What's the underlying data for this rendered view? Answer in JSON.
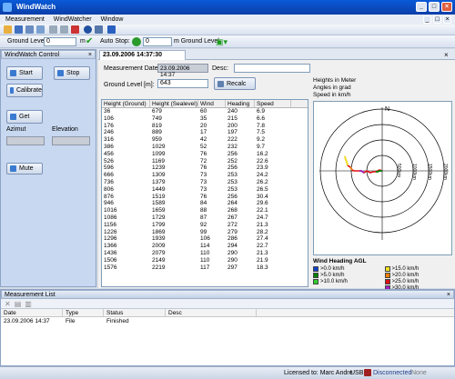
{
  "window": {
    "title": "WindWatch"
  },
  "menu": [
    "Measurement",
    "WindWatcher",
    "Window"
  ],
  "toolbar2": {
    "ground_level_label": "Ground Level:",
    "ground_level_value": "0",
    "ground_level_unit": "m",
    "auto_stop_label": "Auto Stop:",
    "auto_stop_value": "0",
    "m_ground_level_label": "m Ground Level"
  },
  "left_panel": {
    "title": "WindWatch Control",
    "start": "Start",
    "stop": "Stop",
    "calibrate": "Calibrate",
    "get": "Get",
    "azimut": "Azimut",
    "elevation": "Elevation",
    "mute": "Mute"
  },
  "tab": {
    "label": "23.09.2006 14:37:30"
  },
  "form": {
    "measurement_date_label": "Measurement Date:",
    "measurement_date_value": "23.09.2006 14:37",
    "desc_label": "Desc:",
    "desc_value": "",
    "ground_level_label": "Ground Level [m]:",
    "ground_level_value": "643",
    "recalc": "Recalc"
  },
  "info": [
    "Heights in Meter",
    "Angles in grad",
    "Speed in km/h"
  ],
  "table": {
    "headers": [
      "Height (Ground)",
      "Height (Sealevel)",
      "Wind",
      "Heading",
      "Speed"
    ],
    "rows": [
      [
        "36",
        "679",
        "60",
        "240",
        "6.9"
      ],
      [
        "106",
        "749",
        "35",
        "215",
        "6.6"
      ],
      [
        "176",
        "819",
        "20",
        "200",
        "7.8"
      ],
      [
        "246",
        "889",
        "17",
        "197",
        "7.5"
      ],
      [
        "316",
        "959",
        "42",
        "222",
        "9.2"
      ],
      [
        "386",
        "1029",
        "52",
        "232",
        "9.7"
      ],
      [
        "456",
        "1099",
        "76",
        "256",
        "16.2"
      ],
      [
        "526",
        "1169",
        "72",
        "252",
        "22.6"
      ],
      [
        "596",
        "1239",
        "76",
        "256",
        "23.9"
      ],
      [
        "666",
        "1309",
        "73",
        "253",
        "24.2"
      ],
      [
        "736",
        "1379",
        "73",
        "253",
        "26.2"
      ],
      [
        "806",
        "1449",
        "73",
        "253",
        "26.5"
      ],
      [
        "876",
        "1519",
        "76",
        "256",
        "30.4"
      ],
      [
        "946",
        "1589",
        "84",
        "264",
        "29.6"
      ],
      [
        "1016",
        "1659",
        "88",
        "268",
        "22.1"
      ],
      [
        "1086",
        "1729",
        "87",
        "267",
        "24.7"
      ],
      [
        "1156",
        "1799",
        "92",
        "272",
        "21.3"
      ],
      [
        "1226",
        "1869",
        "99",
        "279",
        "28.2"
      ],
      [
        "1296",
        "1939",
        "106",
        "286",
        "27.4"
      ],
      [
        "1366",
        "2009",
        "114",
        "294",
        "22.7"
      ],
      [
        "1436",
        "2079",
        "110",
        "290",
        "21.3"
      ],
      [
        "1506",
        "2149",
        "110",
        "290",
        "21.9"
      ],
      [
        "1576",
        "2219",
        "117",
        "297",
        "18.3"
      ]
    ]
  },
  "plot": {
    "north": "N",
    "ring_labels": [
      "500km",
      "1000km",
      "1500km",
      "2000km"
    ]
  },
  "legend": {
    "title": "Wind Heading AGL",
    "items": [
      {
        "label": ">0.0 km/h",
        "color": "#1040d0"
      },
      {
        "label": ">15.0 km/h",
        "color": "#f0e020"
      },
      {
        "label": ">5.0 km/h",
        "color": "#008000"
      },
      {
        "label": ">20.0 km/h",
        "color": "#f08000"
      },
      {
        "label": ">10.0 km/h",
        "color": "#30d030"
      },
      {
        "label": ">25.0 km/h",
        "color": "#e01010"
      },
      {
        "label": "",
        "color": ""
      },
      {
        "label": ">30.0 km/h",
        "color": "#a020c0"
      }
    ]
  },
  "measurement_list": {
    "title": "Measurement List",
    "headers": [
      "Date",
      "Type",
      "Status",
      "Desc"
    ],
    "rows": [
      [
        "23.09.2006 14:37",
        "File",
        "Finished",
        ""
      ]
    ]
  },
  "status": {
    "licensed": "Licensed to: Marc Andre",
    "usb": "USB",
    "disconnected": "Disconnected",
    "none": "None"
  }
}
